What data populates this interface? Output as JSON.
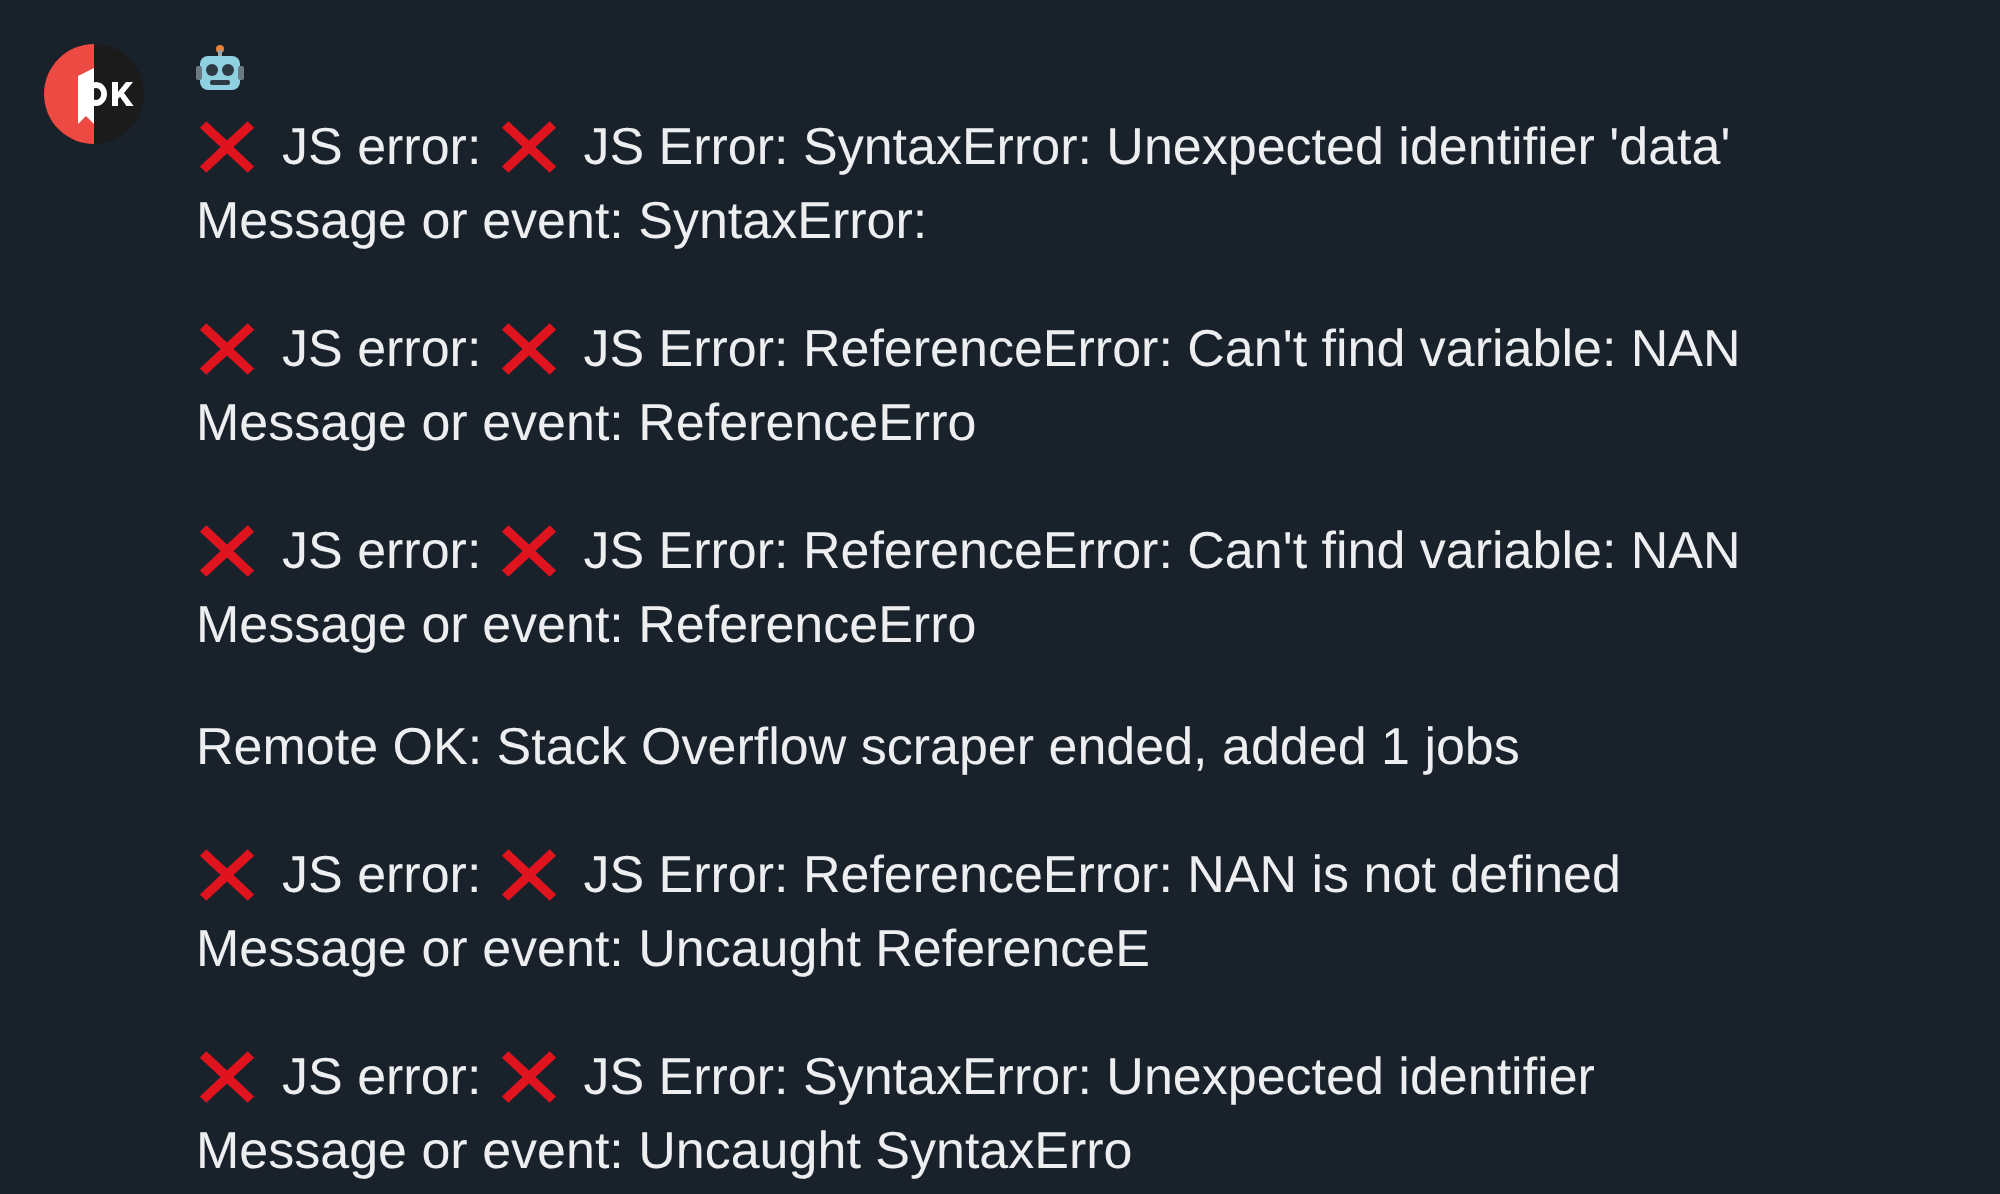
{
  "messages": [
    {
      "kind": "error",
      "label": "JS error:",
      "detail": "JS Error: SyntaxError: Unexpected identifier 'data'",
      "event": "Message or event: SyntaxError:"
    },
    {
      "kind": "error",
      "label": "JS error:",
      "detail": "JS Error: ReferenceError: Can't find variable: NAN",
      "event": "Message or event: ReferenceErro"
    },
    {
      "kind": "error",
      "label": "JS error:",
      "detail": "JS Error: ReferenceError: Can't find variable: NAN",
      "event": "Message or event: ReferenceErro"
    },
    {
      "kind": "info",
      "text": "Remote OK: Stack Overflow scraper ended, added 1 jobs"
    },
    {
      "kind": "error",
      "label": "JS error:",
      "detail": "JS Error: ReferenceError: NAN is not defined",
      "event": "Message or event: Uncaught ReferenceE"
    },
    {
      "kind": "error",
      "label": "JS error:",
      "detail": "JS Error: SyntaxError: Unexpected identifier",
      "event": "Message or event: Uncaught SyntaxErro"
    }
  ]
}
